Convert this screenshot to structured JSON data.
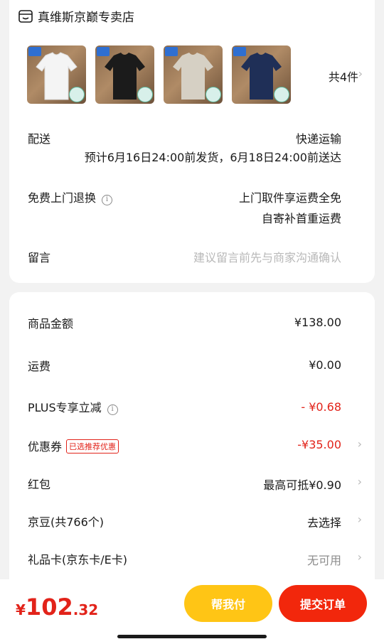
{
  "shop": {
    "name": "真维斯京巅专卖店",
    "icon": "shop-icon"
  },
  "products": {
    "thumbnails": [
      {
        "color": "#ffffff",
        "shirt": "#f4f4f4"
      },
      {
        "color": "#000000",
        "shirt": "#1b1b1b"
      },
      {
        "color": "#d9d3c8",
        "shirt": "#d6d0c4"
      },
      {
        "color": "#1c2e55",
        "shirt": "#1f2f57"
      }
    ],
    "count_label": "共4件"
  },
  "delivery": {
    "label": "配送",
    "method": "快递运输",
    "estimate": "预计6月16日24:00前发货，6月18日24:00前送达"
  },
  "returns": {
    "label": "免费上门退换",
    "line1": "上门取件享运费全免",
    "line2": "自寄补首重运费"
  },
  "message": {
    "label": "留言",
    "placeholder": "建议留言前先与商家沟通确认"
  },
  "price": {
    "goods_label": "商品金额",
    "goods_value": "¥138.00",
    "shipping_label": "运费",
    "shipping_value": "¥0.00",
    "plus_label": "PLUS专享立减",
    "plus_value": "- ¥0.68",
    "coupon_label": "优惠券",
    "coupon_tag": "已选推荐优惠",
    "coupon_value": "-¥35.00",
    "redpacket_label": "红包",
    "redpacket_value": "最高可抵¥0.90",
    "jingdou_label": "京豆(共766个)",
    "jingdou_value": "去选择",
    "giftcard_label": "礼品卡(京东卡/E卡)",
    "giftcard_value": "无可用"
  },
  "footer": {
    "currency": "¥",
    "total_int": "102",
    "total_dec": ".32",
    "help_pay": "帮我付",
    "submit": "提交订单"
  },
  "colors": {
    "accent_red": "#e2231a",
    "help_yellow": "#ffc515",
    "submit_red": "#f2270c"
  }
}
